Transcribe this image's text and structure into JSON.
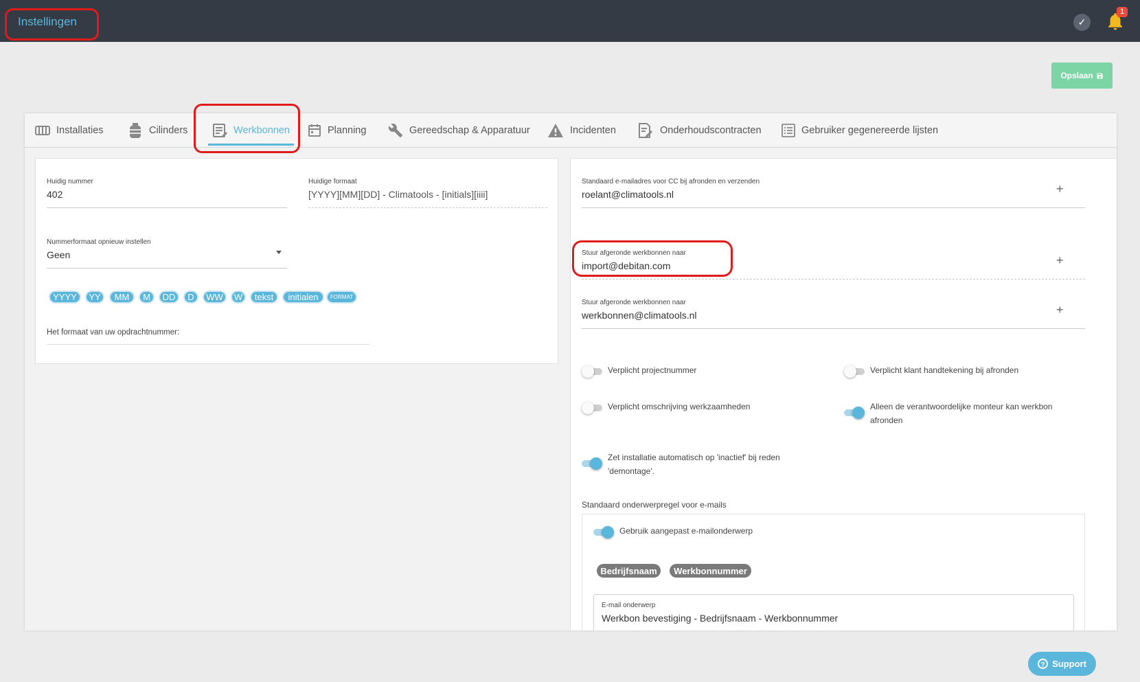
{
  "header": {
    "title": "Instellingen",
    "notification_count": "1"
  },
  "toolbar": {
    "save_label": "Opslaan"
  },
  "tabs": [
    {
      "label": "Installaties",
      "icon": "radiator-icon"
    },
    {
      "label": "Cilinders",
      "icon": "cylinder-icon"
    },
    {
      "label": "Werkbonnen",
      "icon": "document-edit-icon",
      "active": true
    },
    {
      "label": "Planning",
      "icon": "calendar-icon"
    },
    {
      "label": "Gereedschap & Apparatuur",
      "icon": "wrench-icon"
    },
    {
      "label": "Incidenten",
      "icon": "warning-icon"
    },
    {
      "label": "Onderhoudscontracten",
      "icon": "contract-icon"
    },
    {
      "label": "Gebruiker gegenereerde lijsten",
      "icon": "list-icon"
    }
  ],
  "left": {
    "current_number_label": "Huidig nummer",
    "current_number": "402",
    "current_format_label": "Huidige formaat",
    "current_format": "[YYYY][MM][DD] - Climatools - [initials][iiii]",
    "reset_label": "Nummerformaat opnieuw instellen",
    "reset_value": "Geen",
    "chips": [
      "YYYY",
      "YY",
      "MM",
      "M",
      "DD",
      "D",
      "WW",
      "W",
      "tekst",
      "initialen",
      "FORMAT"
    ],
    "format_label": "Het formaat van uw opdrachtnummer:"
  },
  "right": {
    "cc_label": "Standaard e-mailadres voor CC bij afronden en verzenden",
    "cc_value": "roelant@climatools.nl",
    "send1_label": "Stuur afgeronde werkbonnen naar",
    "send1_value": "import@debitan.com",
    "send2_label": "Stuur afgeronde werkbonnen naar",
    "send2_value": "werkbonnen@climatools.nl",
    "toggles": {
      "project_number": {
        "label": "Verplicht projectnummer",
        "on": false
      },
      "customer_signature": {
        "label": "Verplicht klant handtekening bij afronden",
        "on": false
      },
      "work_description": {
        "label": "Verplicht omschrijving werkzaamheden",
        "on": false
      },
      "responsible_only": {
        "label": "Alleen de verantwoordelijke monteur kan werkbon afronden",
        "on": true
      },
      "auto_inactive": {
        "label": "Zet installatie automatisch op 'inactief' bij reden 'demontage'.",
        "on": true
      }
    },
    "subject_section_label": "Standaard onderwerpregel voor e-mails",
    "custom_subject": {
      "label": "Gebruik aangepast e-mailonderwerp",
      "on": true
    },
    "subject_chips": [
      "Bedrijfsnaam",
      "Werkbonnummer"
    ],
    "email_subject_label": "E-mail onderwerp",
    "email_subject_value": "Werkbon bevestiging - Bedrijfsnaam - Werkbonnummer"
  },
  "support": {
    "label": "Support"
  },
  "colors": {
    "accent": "#5ab6db",
    "topbar": "#343b45",
    "save": "#7cd5a5",
    "highlight": "#e01b1b"
  }
}
